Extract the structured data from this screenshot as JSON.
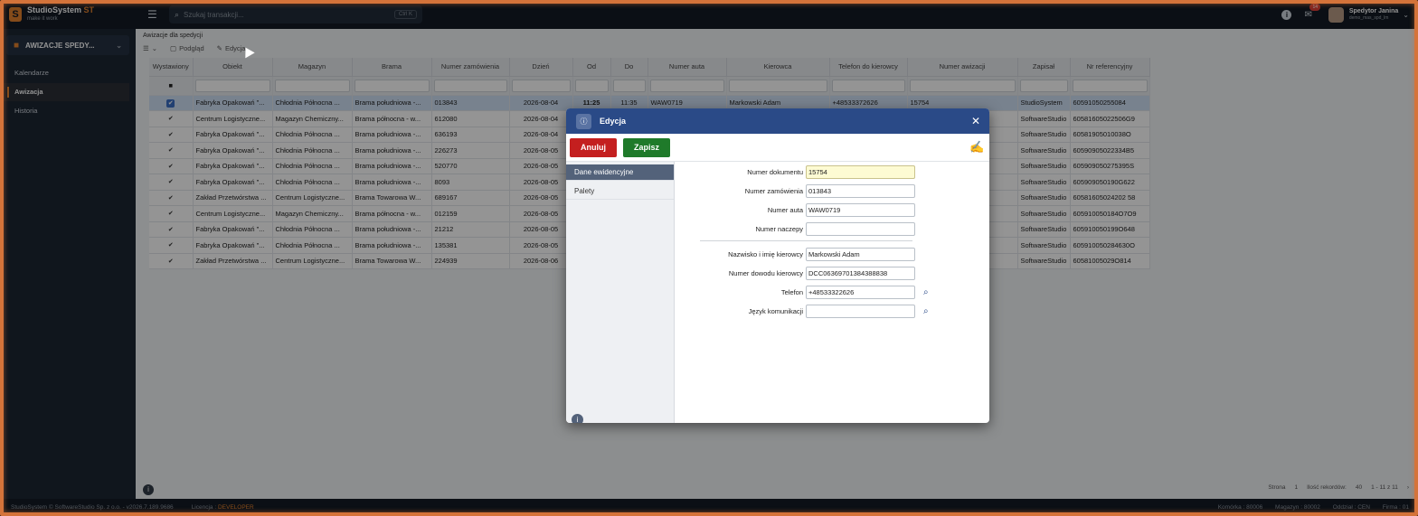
{
  "app": {
    "name": "StudioSystem",
    "name_suffix": "ST",
    "tagline": "make it work",
    "search_placeholder": "Szukaj transakcji...",
    "search_shortcut": "Ctrl  K",
    "notifications_count": "14",
    "user_name": "Spedytor Janina",
    "user_sub": "demo_mas_spd_lm"
  },
  "sidebar": {
    "module_title": "AWIZACJE SPEDY...",
    "items": [
      {
        "label": "Kalendarze"
      },
      {
        "label": "Awizacja"
      },
      {
        "label": "Historia"
      }
    ]
  },
  "main": {
    "breadcrumb": "Awizacje dla spedycji",
    "toolbar": {
      "view_label": "Podgląd",
      "edit_label": "Edycja"
    },
    "columns": [
      "Wystawiony",
      "Obiekt",
      "Magazyn",
      "Brama",
      "Numer zamówienia",
      "Dzień",
      "Od",
      "Do",
      "Numer auta",
      "Kierowca",
      "Telefon do kierowcy",
      "Numer awizacji",
      "Zapisał",
      "Nr referencyjny"
    ],
    "rows": [
      [
        "",
        "Fabryka Opakowań \"...",
        "Chłodnia Północna ...",
        "Brama południowa -...",
        "013843",
        "2026-08-04",
        "11:25",
        "11:35",
        "WAW0719",
        "Markowski Adam",
        "+48533372626",
        "15754",
        "StudioSystem",
        "60591050255084"
      ],
      [
        "",
        "Centrum Logistyczne...",
        "Magazyn Chemiczny...",
        "Brama północna - w...",
        "612080",
        "2026-08-04",
        "",
        "",
        "",
        "",
        "",
        "",
        "SoftwareStudio",
        "60581605022506G9"
      ],
      [
        "",
        "Fabryka Opakowań \"...",
        "Chłodnia Północna ...",
        "Brama południowa -...",
        "636193",
        "2026-08-04",
        "",
        "",
        "",
        "",
        "",
        "",
        "SoftwareStudio",
        "60581905010038O"
      ],
      [
        "",
        "Fabryka Opakowań \"...",
        "Chłodnia Północna ...",
        "Brama południowa -...",
        "226273",
        "2026-08-05",
        "",
        "",
        "",
        "",
        "",
        "",
        "SoftwareStudio",
        "60590905022334B5"
      ],
      [
        "",
        "Fabryka Opakowań \"...",
        "Chłodnia Północna ...",
        "Brama południowa -...",
        "520770",
        "2026-08-05",
        "",
        "",
        "",
        "",
        "",
        "",
        "SoftwareStudio",
        "605909050275395S"
      ],
      [
        "",
        "Fabryka Opakowań \"...",
        "Chłodnia Północna ...",
        "Brama południowa -...",
        "8093",
        "2026-08-05",
        "",
        "",
        "",
        "",
        "",
        "",
        "SoftwareStudio",
        "605909050190G622"
      ],
      [
        "",
        "Zakład Przetwórstwa ...",
        "Centrum Logistyczne...",
        "Brama Towarowa W...",
        "689167",
        "2026-08-05",
        "",
        "",
        "",
        "",
        "",
        "",
        "SoftwareStudio",
        "60581605024202 58"
      ],
      [
        "",
        "Centrum Logistyczne...",
        "Magazyn Chemiczny...",
        "Brama północna - w...",
        "012159",
        "2026-08-05",
        "",
        "",
        "",
        "",
        "",
        "",
        "SoftwareStudio",
        "605910050184O7O9"
      ],
      [
        "",
        "Fabryka Opakowań \"...",
        "Chłodnia Północna ...",
        "Brama południowa -...",
        "21212",
        "2026-08-05",
        "",
        "",
        "",
        "",
        "",
        "",
        "SoftwareStudio",
        "605910050199O648"
      ],
      [
        "",
        "Fabryka Opakowań \"...",
        "Chłodnia Północna ...",
        "Brama południowa -...",
        "135381",
        "2026-08-05",
        "",
        "",
        "",
        "",
        "",
        "",
        "SoftwareStudio",
        "605910050284630O"
      ],
      [
        "",
        "Zakład Przetwórstwa ...",
        "Centrum Logistyczne...",
        "Brama Towarowa W...",
        "224939",
        "2026-08-06",
        "",
        "",
        "",
        "",
        "",
        "",
        "SoftwareStudio",
        "60581005029O814"
      ]
    ],
    "pager": {
      "page_label": "Strona",
      "page": "1",
      "per_page_label": "Ilość rekordów:",
      "per_page": "40",
      "range": "1 - 11 z 11"
    }
  },
  "dialog": {
    "title": "Edycja",
    "cancel_label": "Anuluj",
    "save_label": "Zapisz",
    "tabs": [
      {
        "label": "Dane ewidencyjne"
      },
      {
        "label": "Palety"
      }
    ],
    "fields": [
      {
        "label": "Numer dokumentu",
        "value": "15754"
      },
      {
        "label": "Numer zamówienia",
        "value": "013843"
      },
      {
        "label": "Numer auta",
        "value": "WAW0719"
      },
      {
        "label": "Numer naczepy",
        "value": ""
      },
      {
        "label": "Nazwisko i imię kierowcy",
        "value": "Markowski Adam"
      },
      {
        "label": "Numer dowodu kierowcy",
        "value": "DCC06369701384388838"
      },
      {
        "label": "Telefon",
        "value": "+48533322626"
      },
      {
        "label": "Język komunikacji",
        "value": ""
      }
    ]
  },
  "statusbar": {
    "copyright": "StudioSystem © SoftwareStudio Sp. z o.o. - v2026.7.189.9686",
    "license_label": "Licencja :",
    "license_value": "DEVELOPER",
    "komorka": "Komórka : 80006",
    "magazyn": "Magazyn : 80002",
    "oddzial": "Oddział : CEN",
    "firma": "Firma : 01"
  }
}
